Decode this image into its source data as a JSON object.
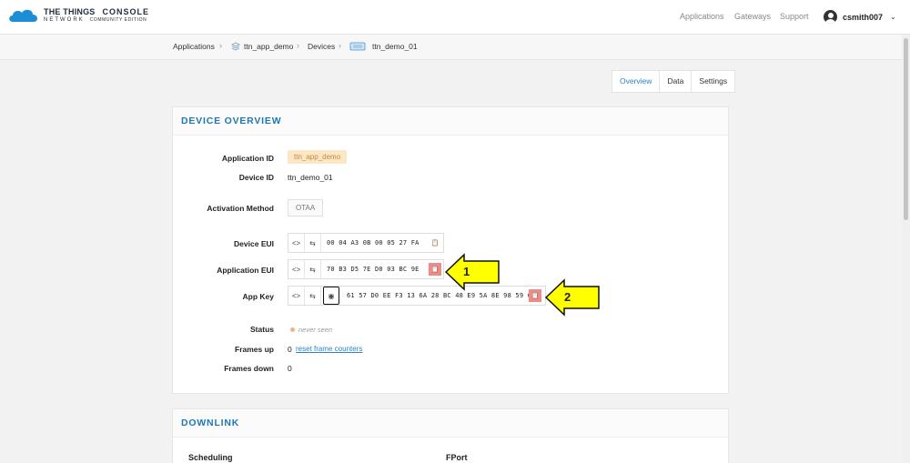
{
  "header": {
    "logo_main": "THE THINGS",
    "logo_console": "CONSOLE",
    "logo_sub": "NETWORK",
    "logo_edition": "COMMUNITY EDITION",
    "nav": [
      "Applications",
      "Gateways",
      "Support"
    ],
    "user": "csmith007"
  },
  "breadcrumb": {
    "items": [
      "Applications",
      "ttn_app_demo",
      "Devices",
      "ttn_demo_01"
    ]
  },
  "tabs": [
    "Overview",
    "Data",
    "Settings"
  ],
  "overview": {
    "title": "DEVICE OVERVIEW",
    "app_id_label": "Application ID",
    "app_id": "ttn_app_demo",
    "device_id_label": "Device ID",
    "device_id": "ttn_demo_01",
    "activation_label": "Activation Method",
    "activation": "OTAA",
    "dev_eui_label": "Device EUI",
    "dev_eui": "00 04 A3 0B 00 05 27 FA",
    "app_eui_label": "Application EUI",
    "app_eui": "70 B3 D5 7E D0 03 BC 9E",
    "app_key_label": "App Key",
    "app_key": "61 57 D0 EE F3 13 6A 28 BC 48 E9 5A 8E 98 59 CC",
    "status_label": "Status",
    "status": "never seen",
    "frames_up_label": "Frames up",
    "frames_up": "0",
    "reset_link": "reset frame counters",
    "frames_down_label": "Frames down",
    "frames_down": "0"
  },
  "annotations": [
    "1",
    "2"
  ],
  "downlink": {
    "title": "DOWNLINK",
    "scheduling_label": "Scheduling",
    "fport_label": "FPort"
  },
  "colors": {
    "accent": "#1f78b4",
    "highlight": "#f08a8a",
    "arrow": "#ffff00"
  }
}
